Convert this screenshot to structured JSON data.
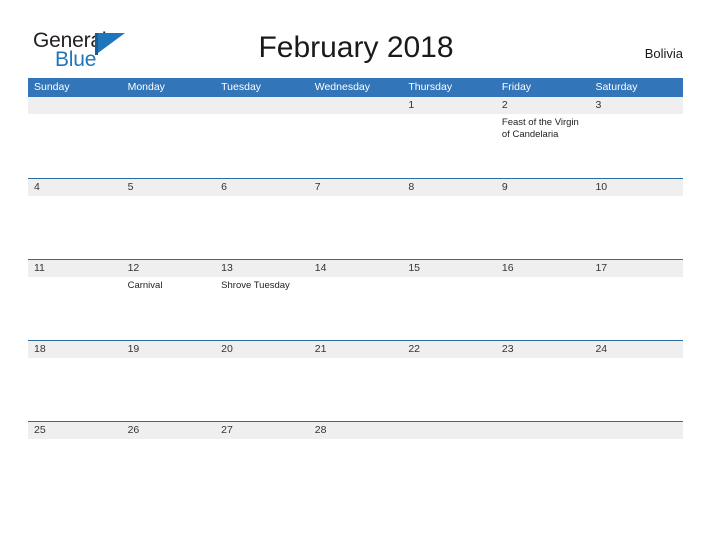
{
  "brand": {
    "name_part1": "General",
    "name_part2": "Blue",
    "flag_icon": "triangle-flag-icon",
    "accent_color": "#1f76bc"
  },
  "header": {
    "title": "February 2018",
    "country": "Bolivia"
  },
  "calendar": {
    "header_color": "#3275b8",
    "band_color": "#efefef",
    "weekdays": [
      "Sunday",
      "Monday",
      "Tuesday",
      "Wednesday",
      "Thursday",
      "Friday",
      "Saturday"
    ],
    "weeks": [
      [
        {
          "day": "",
          "event": ""
        },
        {
          "day": "",
          "event": ""
        },
        {
          "day": "",
          "event": ""
        },
        {
          "day": "",
          "event": ""
        },
        {
          "day": "1",
          "event": ""
        },
        {
          "day": "2",
          "event": "Feast of the Virgin of Candelaria"
        },
        {
          "day": "3",
          "event": ""
        }
      ],
      [
        {
          "day": "4",
          "event": ""
        },
        {
          "day": "5",
          "event": ""
        },
        {
          "day": "6",
          "event": ""
        },
        {
          "day": "7",
          "event": ""
        },
        {
          "day": "8",
          "event": ""
        },
        {
          "day": "9",
          "event": ""
        },
        {
          "day": "10",
          "event": ""
        }
      ],
      [
        {
          "day": "11",
          "event": ""
        },
        {
          "day": "12",
          "event": "Carnival"
        },
        {
          "day": "13",
          "event": "Shrove Tuesday"
        },
        {
          "day": "14",
          "event": ""
        },
        {
          "day": "15",
          "event": ""
        },
        {
          "day": "16",
          "event": ""
        },
        {
          "day": "17",
          "event": ""
        }
      ],
      [
        {
          "day": "18",
          "event": ""
        },
        {
          "day": "19",
          "event": ""
        },
        {
          "day": "20",
          "event": ""
        },
        {
          "day": "21",
          "event": ""
        },
        {
          "day": "22",
          "event": ""
        },
        {
          "day": "23",
          "event": ""
        },
        {
          "day": "24",
          "event": ""
        }
      ],
      [
        {
          "day": "25",
          "event": ""
        },
        {
          "day": "26",
          "event": ""
        },
        {
          "day": "27",
          "event": ""
        },
        {
          "day": "28",
          "event": ""
        },
        {
          "day": "",
          "event": ""
        },
        {
          "day": "",
          "event": ""
        },
        {
          "day": "",
          "event": ""
        }
      ]
    ]
  }
}
